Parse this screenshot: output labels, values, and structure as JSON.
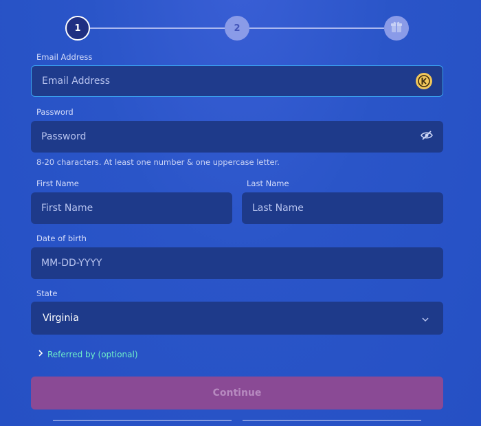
{
  "stepper": {
    "steps": [
      {
        "label": "1",
        "state": "active"
      },
      {
        "label": "2",
        "state": "todo"
      },
      {
        "label": "gift-icon",
        "state": "todo"
      }
    ]
  },
  "form": {
    "email": {
      "label": "Email Address",
      "placeholder": "Email Address",
      "value": ""
    },
    "password": {
      "label": "Password",
      "placeholder": "Password",
      "value": "",
      "hint": "8-20 characters. At least one number & one uppercase letter."
    },
    "first_name": {
      "label": "First Name",
      "placeholder": "First Name",
      "value": ""
    },
    "last_name": {
      "label": "Last Name",
      "placeholder": "Last Name",
      "value": ""
    },
    "dob": {
      "label": "Date of birth",
      "placeholder": "MM-DD-YYYY",
      "value": ""
    },
    "state": {
      "label": "State",
      "value": "Virginia"
    },
    "referred": {
      "label": "Referred by (optional)"
    },
    "continue_label": "Continue"
  },
  "colors": {
    "background": "#2550c4",
    "field": "#1e3a8a",
    "accent_focus": "#3aa2f0",
    "referred_link": "#6ff0c9",
    "continue_button": "#8a4a95"
  }
}
